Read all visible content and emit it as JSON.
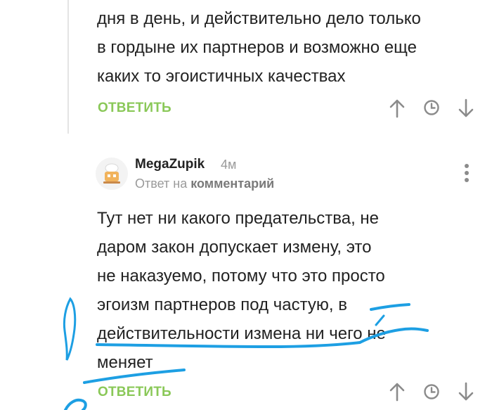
{
  "comment1": {
    "lines": [
      "дня в день, и действительно дело только",
      "в гордыне их партнеров и возможно еще",
      "каких то эгоистичных качествах"
    ],
    "reply_label": "ОТВЕТИТЬ"
  },
  "comment2": {
    "author": "MegaZupik",
    "time": "4м",
    "reply_prefix": "Ответ на",
    "reply_target": "комментарий",
    "lines": [
      "Тут нет ни какого предательства, не",
      "даром закон допускает измену, это",
      "не наказуемо, потому что это просто",
      "эгоизм партнеров под частую, в",
      "действительности измена ни чего не",
      "меняет"
    ],
    "reply_label": "ОТВЕТИТЬ"
  },
  "icons": {
    "upvote": "arrow-up-icon",
    "save": "clock-icon",
    "downvote": "arrow-down-icon",
    "more": "more-vertical-icon"
  },
  "colors": {
    "reply": "#8ac858",
    "annotation": "#1d9fe3",
    "muted": "#9a9a9a"
  }
}
